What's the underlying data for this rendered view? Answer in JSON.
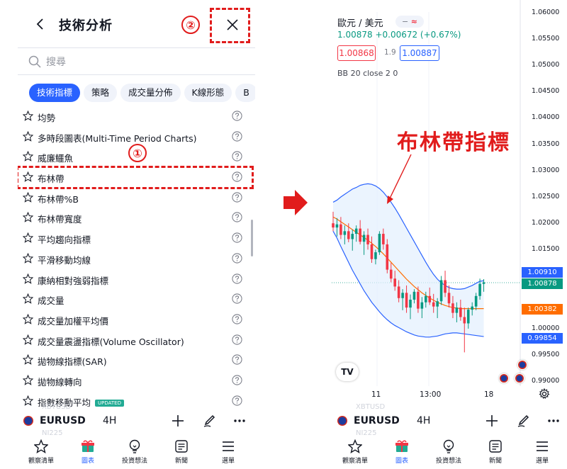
{
  "left": {
    "header": {
      "title": "技術分析",
      "step_close": "②"
    },
    "search": {
      "placeholder": "搜尋"
    },
    "chips": [
      "技術指標",
      "策略",
      "成交量分佈",
      "K線形態",
      "B"
    ],
    "items": [
      {
        "label": "均勢"
      },
      {
        "label": "多時段圖表(Multi-Time Period Charts)"
      },
      {
        "label": "威廉鱷魚"
      },
      {
        "label": "布林帶"
      },
      {
        "label": "布林帶%B"
      },
      {
        "label": "布林帶寬度"
      },
      {
        "label": "平均趨向指標"
      },
      {
        "label": "平滑移動均線"
      },
      {
        "label": "康納相對強弱指標"
      },
      {
        "label": "成交量"
      },
      {
        "label": "成交量加權平均價"
      },
      {
        "label": "成交量震盪指標(Volume Oscillator)"
      },
      {
        "label": "拋物線指標(SAR)"
      },
      {
        "label": "拋物線轉向"
      },
      {
        "label": "指數移動平均",
        "badge": "UPDATED"
      }
    ],
    "step_item": "①",
    "symbol_bar": {
      "symbol": "EURUSD",
      "interval": "4H",
      "ghost_top": "XBTUSD",
      "ghost_bottom": "NI225"
    },
    "tabs": [
      "觀察清單",
      "圖表",
      "投資想法",
      "新聞",
      "選單"
    ]
  },
  "right": {
    "pair": "歐元 / 美元",
    "pair_btn_a": "−",
    "pair_btn_b": "≈",
    "quote": "1.00878 +0.00672 (+0.67%)",
    "bid": "1.00868",
    "spread": "1.9",
    "ask": "1.00887",
    "bb_legend": "BB 20 close 2 0",
    "annotation": "布林帶指標",
    "price_labels": {
      "upper": "1.00910",
      "last": "1.00878",
      "ma": "1.00382",
      "lower": "0.99854"
    },
    "symbol_bar": {
      "symbol": "EURUSD",
      "interval": "4H",
      "ghost_top": "XBTUSD",
      "ghost_bottom": "NI225"
    },
    "tabs": [
      "觀察清單",
      "圖表",
      "投資想法",
      "新聞",
      "選單"
    ],
    "logo": "TV"
  },
  "chart_data": {
    "type": "candlestick",
    "title": "歐元 / 美元",
    "y_ticks": [
      "1.06000",
      "1.05500",
      "1.05000",
      "1.04500",
      "1.04000",
      "1.03500",
      "1.03000",
      "1.02500",
      "1.02000",
      "1.01500",
      "1.01000",
      "1.00000",
      "0.99500",
      "0.99000"
    ],
    "x_ticks": [
      "11",
      "13:00",
      "18"
    ],
    "ylim": [
      0.9899,
      1.0601
    ],
    "candles": [
      [
        1.02,
        1.0222,
        1.0185,
        1.0192
      ],
      [
        1.0192,
        1.021,
        1.0175,
        1.0198
      ],
      [
        1.0198,
        1.0212,
        1.017,
        1.0178
      ],
      [
        1.0178,
        1.0196,
        1.016,
        1.0185
      ],
      [
        1.0185,
        1.02,
        1.0164,
        1.017
      ],
      [
        1.017,
        1.0188,
        1.0148,
        1.018
      ],
      [
        1.018,
        1.0196,
        1.0165,
        1.019
      ],
      [
        1.019,
        1.0206,
        1.016,
        1.0165
      ],
      [
        1.0165,
        1.0185,
        1.014,
        1.0178
      ],
      [
        1.0178,
        1.019,
        1.015,
        1.016
      ],
      [
        1.016,
        1.0175,
        1.0125,
        1.0132
      ],
      [
        1.0132,
        1.015,
        1.0122,
        1.0145
      ],
      [
        1.0145,
        1.0185,
        1.014,
        1.018
      ],
      [
        1.018,
        1.019,
        1.015,
        1.016
      ],
      [
        1.016,
        1.017,
        1.0105,
        1.0112
      ],
      [
        1.0112,
        1.0125,
        1.0088,
        1.0095
      ],
      [
        1.0095,
        1.011,
        1.0072,
        1.008
      ],
      [
        1.008,
        1.0092,
        1.005,
        1.0058
      ],
      [
        1.0058,
        1.0075,
        1.0035,
        1.0068
      ],
      [
        1.0068,
        1.0082,
        1.003,
        1.004
      ],
      [
        1.004,
        1.0065,
        1.0018,
        1.0055
      ],
      [
        1.0055,
        1.0075,
        1.0048,
        1.007
      ],
      [
        1.007,
        1.008,
        1.003,
        1.0038
      ],
      [
        1.0038,
        1.006,
        1.002,
        1.005
      ],
      [
        1.005,
        1.007,
        1.004,
        1.0062
      ],
      [
        1.0062,
        1.0078,
        1.0045,
        1.005
      ],
      [
        1.005,
        1.0066,
        1.003,
        1.0042
      ],
      [
        1.0042,
        1.0058,
        1.002,
        1.0052
      ],
      [
        1.0052,
        1.01,
        1.0045,
        1.0092
      ],
      [
        1.0092,
        1.011,
        1.006,
        1.0068
      ],
      [
        1.0068,
        1.0082,
        1.004,
        1.0048
      ],
      [
        1.0048,
        1.0062,
        1.002,
        1.003
      ],
      [
        1.003,
        1.005,
        1.0012,
        1.004
      ],
      [
        1.004,
        1.0055,
        1.0015,
        1.0022
      ],
      [
        1.0022,
        1.004,
        0.9955,
        1.001
      ],
      [
        1.001,
        1.004,
        1.0,
        1.0036
      ],
      [
        1.0036,
        1.005,
        1.0025,
        1.0042
      ],
      [
        1.0042,
        1.0068,
        1.0035,
        1.0062
      ],
      [
        1.0062,
        1.0095,
        1.0055,
        1.0085
      ],
      [
        1.0085,
        1.0094,
        1.007,
        1.0088
      ]
    ],
    "upper_band": [
      1.024,
      1.0244,
      1.025,
      1.0255,
      1.026,
      1.0265,
      1.0268,
      1.0272,
      1.0274,
      1.0275,
      1.0274,
      1.0271,
      1.0266,
      1.0259,
      1.025,
      1.024,
      1.0229,
      1.0217,
      1.0204,
      1.0191,
      1.0178,
      1.0165,
      1.0152,
      1.0139,
      1.0126,
      1.0114,
      1.0103,
      1.0094,
      1.0087,
      1.0082,
      1.0078,
      1.0076,
      1.0075,
      1.0075,
      1.0076,
      1.0079,
      1.0082,
      1.0086,
      1.009,
      1.0091
    ],
    "middle_band": [
      1.0212,
      1.0208,
      1.0203,
      1.0198,
      1.0193,
      1.0188,
      1.0183,
      1.0178,
      1.0173,
      1.0168,
      1.0162,
      1.0156,
      1.0149,
      1.0142,
      1.0134,
      1.0126,
      1.0118,
      1.011,
      1.0102,
      1.0094,
      1.0087,
      1.008,
      1.0074,
      1.0068,
      1.0063,
      1.0058,
      1.0054,
      1.005,
      1.0047,
      1.0044,
      1.0042,
      1.004,
      1.0039,
      1.0038,
      1.0038,
      1.0038,
      1.0038,
      1.0038,
      1.0038,
      1.0038
    ],
    "lower_band": [
      1.0185,
      1.0172,
      1.0156,
      1.0141,
      1.0126,
      1.0111,
      1.0098,
      1.0085,
      1.0072,
      1.0061,
      1.005,
      1.0041,
      1.0032,
      1.0024,
      1.0017,
      1.0011,
      1.0006,
      1.0002,
      0.9998,
      0.9994,
      0.9991,
      0.9988,
      0.9986,
      0.9985,
      0.9984,
      0.9984,
      0.9985,
      0.9986,
      0.9988,
      0.999,
      0.9991,
      0.9992,
      0.9992,
      0.9991,
      0.999,
      0.9989,
      0.9988,
      0.9987,
      0.9986,
      0.9985
    ],
    "colors": {
      "up": "#089981",
      "down": "#f23645",
      "band": "#2962ff",
      "basis": "#ff6d00",
      "fill": "#e3effd"
    }
  }
}
